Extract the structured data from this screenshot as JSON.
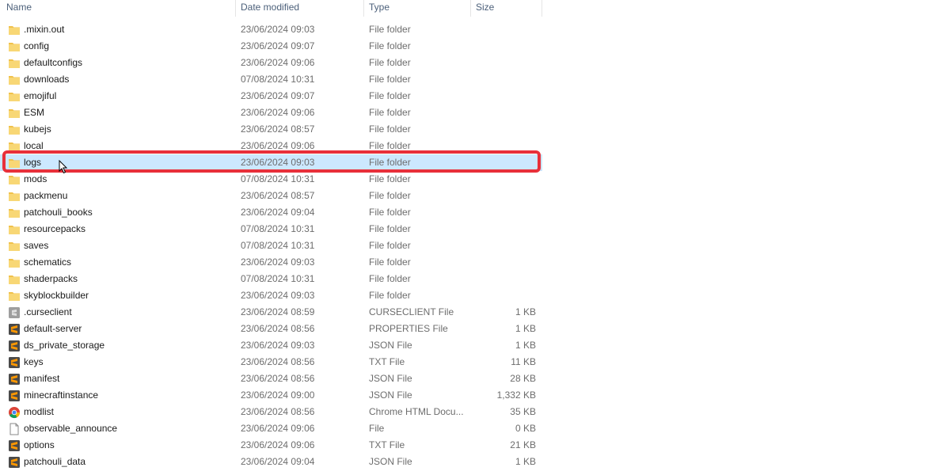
{
  "columns": {
    "name": "Name",
    "date": "Date modified",
    "type": "Type",
    "size": "Size"
  },
  "colors": {
    "selection": "#cce8ff",
    "highlight": "#e8303a",
    "folder": "#f8d775"
  },
  "files": [
    {
      "name": ".mixin.out",
      "date": "23/06/2024 09:03",
      "type": "File folder",
      "size": "",
      "icon": "folder-icon",
      "selected": false
    },
    {
      "name": "config",
      "date": "23/06/2024 09:07",
      "type": "File folder",
      "size": "",
      "icon": "folder-icon",
      "selected": false
    },
    {
      "name": "defaultconfigs",
      "date": "23/06/2024 09:06",
      "type": "File folder",
      "size": "",
      "icon": "folder-icon",
      "selected": false
    },
    {
      "name": "downloads",
      "date": "07/08/2024 10:31",
      "type": "File folder",
      "size": "",
      "icon": "folder-icon",
      "selected": false
    },
    {
      "name": "emojiful",
      "date": "23/06/2024 09:07",
      "type": "File folder",
      "size": "",
      "icon": "folder-icon",
      "selected": false
    },
    {
      "name": "ESM",
      "date": "23/06/2024 09:06",
      "type": "File folder",
      "size": "",
      "icon": "folder-icon",
      "selected": false
    },
    {
      "name": "kubejs",
      "date": "23/06/2024 08:57",
      "type": "File folder",
      "size": "",
      "icon": "folder-icon",
      "selected": false
    },
    {
      "name": "local",
      "date": "23/06/2024 09:06",
      "type": "File folder",
      "size": "",
      "icon": "folder-icon",
      "selected": false
    },
    {
      "name": "logs",
      "date": "23/06/2024 09:03",
      "type": "File folder",
      "size": "",
      "icon": "folder-icon",
      "selected": true
    },
    {
      "name": "mods",
      "date": "07/08/2024 10:31",
      "type": "File folder",
      "size": "",
      "icon": "folder-icon",
      "selected": false
    },
    {
      "name": "packmenu",
      "date": "23/06/2024 08:57",
      "type": "File folder",
      "size": "",
      "icon": "folder-icon",
      "selected": false
    },
    {
      "name": "patchouli_books",
      "date": "23/06/2024 09:04",
      "type": "File folder",
      "size": "",
      "icon": "folder-icon",
      "selected": false
    },
    {
      "name": "resourcepacks",
      "date": "07/08/2024 10:31",
      "type": "File folder",
      "size": "",
      "icon": "folder-icon",
      "selected": false
    },
    {
      "name": "saves",
      "date": "07/08/2024 10:31",
      "type": "File folder",
      "size": "",
      "icon": "folder-icon",
      "selected": false
    },
    {
      "name": "schematics",
      "date": "23/06/2024 09:03",
      "type": "File folder",
      "size": "",
      "icon": "folder-icon",
      "selected": false
    },
    {
      "name": "shaderpacks",
      "date": "07/08/2024 10:31",
      "type": "File folder",
      "size": "",
      "icon": "folder-icon",
      "selected": false
    },
    {
      "name": "skyblockbuilder",
      "date": "23/06/2024 09:03",
      "type": "File folder",
      "size": "",
      "icon": "folder-icon",
      "selected": false
    },
    {
      "name": ".curseclient",
      "date": "23/06/2024 08:59",
      "type": "CURSECLIENT File",
      "size": "1 KB",
      "icon": "gray-file-icon",
      "selected": false
    },
    {
      "name": "default-server",
      "date": "23/06/2024 08:56",
      "type": "PROPERTIES File",
      "size": "1 KB",
      "icon": "sublime-file-icon",
      "selected": false
    },
    {
      "name": "ds_private_storage",
      "date": "23/06/2024 09:03",
      "type": "JSON File",
      "size": "1 KB",
      "icon": "sublime-file-icon",
      "selected": false
    },
    {
      "name": "keys",
      "date": "23/06/2024 08:56",
      "type": "TXT File",
      "size": "11 KB",
      "icon": "sublime-file-icon",
      "selected": false
    },
    {
      "name": "manifest",
      "date": "23/06/2024 08:56",
      "type": "JSON File",
      "size": "28 KB",
      "icon": "sublime-file-icon",
      "selected": false
    },
    {
      "name": "minecraftinstance",
      "date": "23/06/2024 09:00",
      "type": "JSON File",
      "size": "1,332 KB",
      "icon": "sublime-file-icon",
      "selected": false
    },
    {
      "name": "modlist",
      "date": "23/06/2024 08:56",
      "type": "Chrome HTML Docu...",
      "size": "35 KB",
      "icon": "chrome-icon",
      "selected": false
    },
    {
      "name": "observable_announce",
      "date": "23/06/2024 09:06",
      "type": "File",
      "size": "0 KB",
      "icon": "blank-file-icon",
      "selected": false
    },
    {
      "name": "options",
      "date": "23/06/2024 09:06",
      "type": "TXT File",
      "size": "21 KB",
      "icon": "sublime-file-icon",
      "selected": false
    },
    {
      "name": "patchouli_data",
      "date": "23/06/2024 09:04",
      "type": "JSON File",
      "size": "1 KB",
      "icon": "sublime-file-icon",
      "selected": false
    }
  ]
}
